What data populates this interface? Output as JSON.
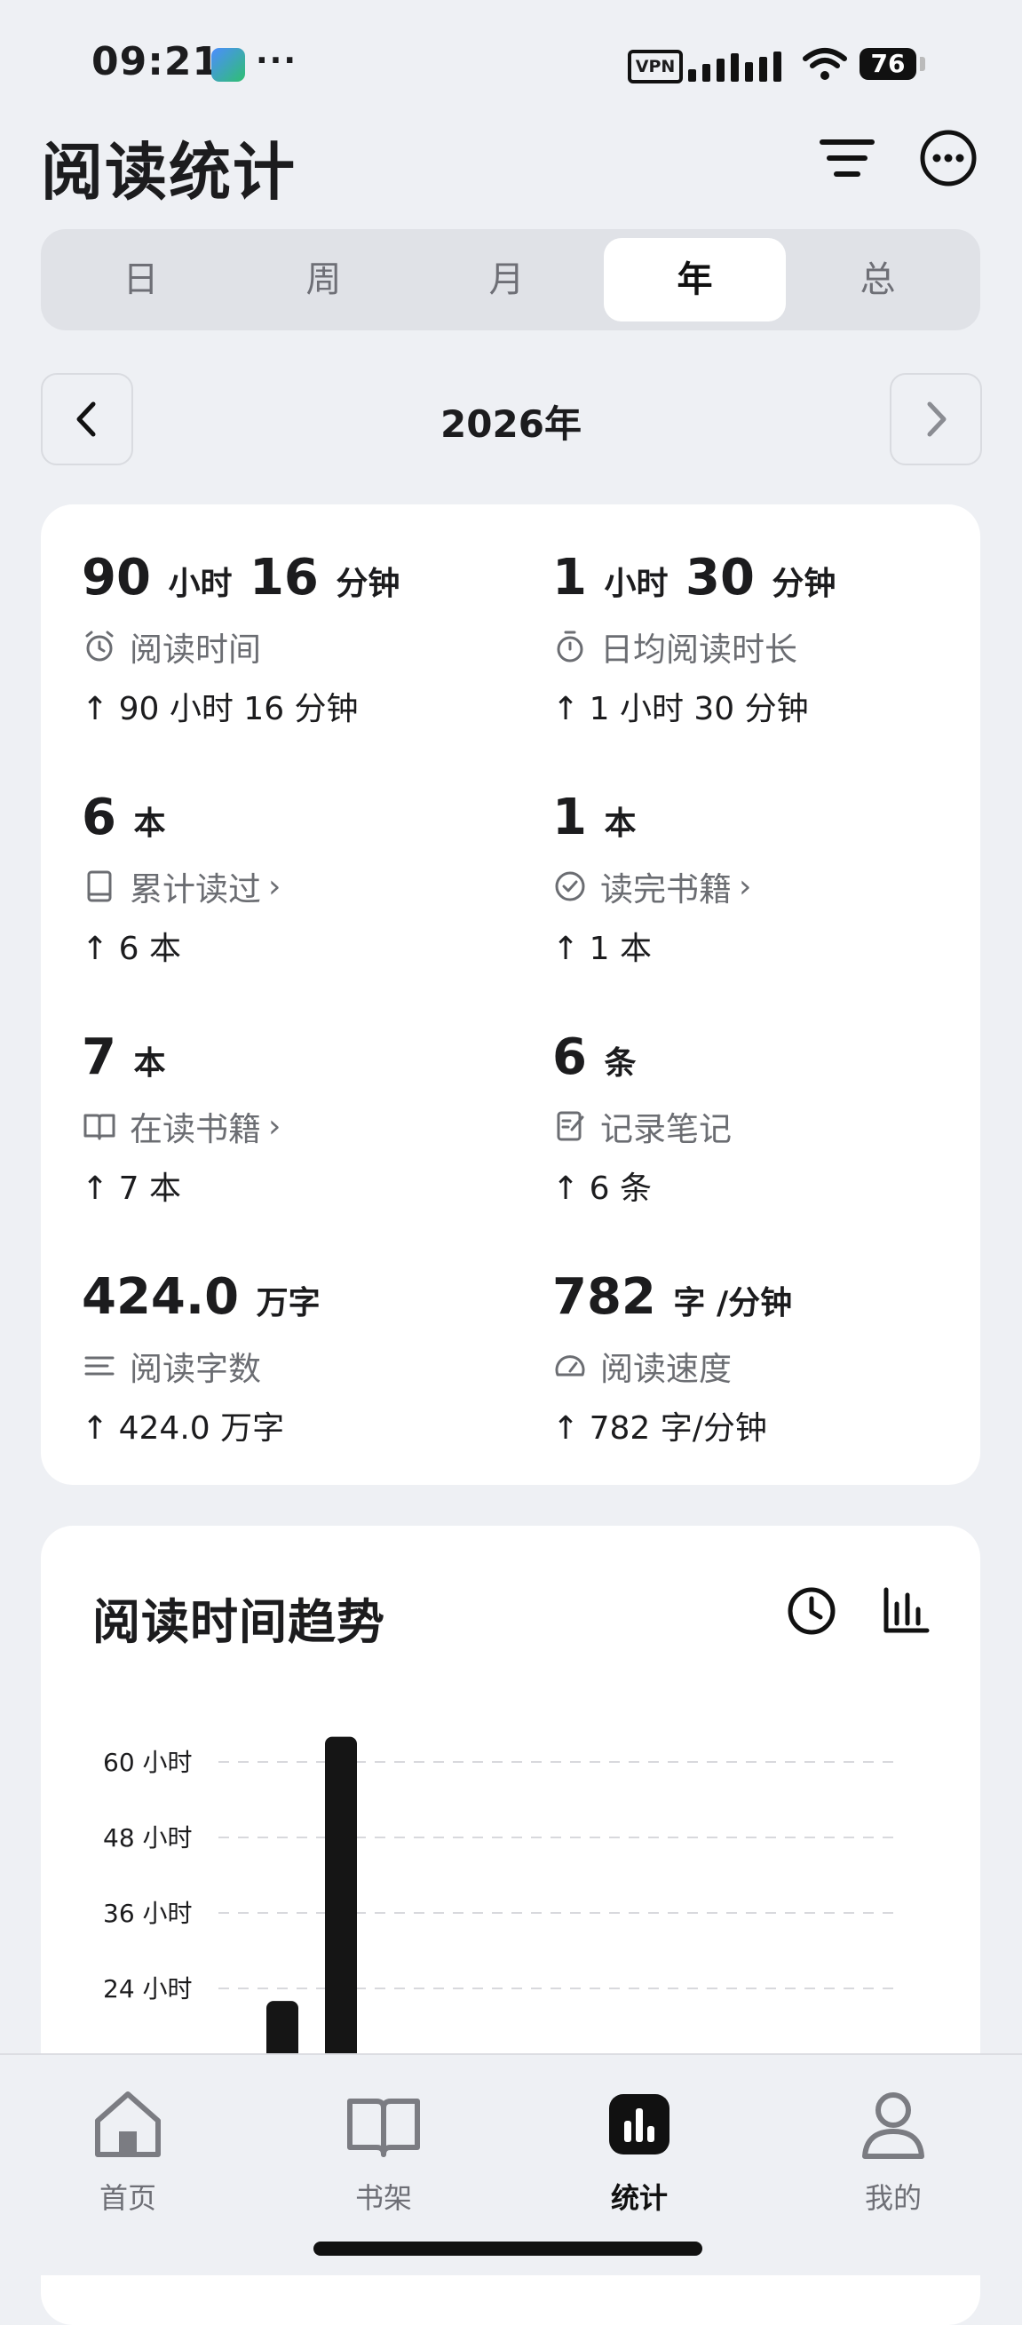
{
  "status_bar": {
    "time": "09:21",
    "dots": "···",
    "vpn": "VPN",
    "battery": "76"
  },
  "header": {
    "title": "阅读统计"
  },
  "segments": [
    {
      "label": "日",
      "active": false
    },
    {
      "label": "周",
      "active": false
    },
    {
      "label": "月",
      "active": false
    },
    {
      "label": "年",
      "active": true
    },
    {
      "label": "总",
      "active": false
    }
  ],
  "period": {
    "label": "2026年"
  },
  "stats": {
    "reading_time": {
      "h": "90",
      "h_unit": "小时",
      "m": "16",
      "m_unit": "分钟",
      "label": "阅读时间",
      "change": "↑ 90 小时 16 分钟"
    },
    "daily_avg": {
      "h": "1",
      "h_unit": "小时",
      "m": "30",
      "m_unit": "分钟",
      "label": "日均阅读时长",
      "change": "↑ 1 小时 30 分钟"
    },
    "books_read": {
      "value": "6",
      "unit": "本",
      "label": "累计读过",
      "change": "↑ 6 本"
    },
    "books_finished": {
      "value": "1",
      "unit": "本",
      "label": "读完书籍",
      "change": "↑ 1 本"
    },
    "books_reading": {
      "value": "7",
      "unit": "本",
      "label": "在读书籍",
      "change": "↑ 7 本"
    },
    "notes": {
      "value": "6",
      "unit": "条",
      "label": "记录笔记",
      "change": "↑ 6 条"
    },
    "words": {
      "value": "424.0",
      "unit": "万字",
      "label": "阅读字数",
      "change": "↑ 424.0 万字"
    },
    "speed": {
      "value": "782",
      "unit": "字 /分钟",
      "label": "阅读速度",
      "change": "↑ 782 字/分钟"
    }
  },
  "chart": {
    "title": "阅读时间趋势",
    "icons": [
      "clock-icon",
      "bar-chart-icon"
    ]
  },
  "chart_data": {
    "type": "bar",
    "title": "阅读时间趋势",
    "ylabel": "",
    "ytick_labels": [
      "60 小时",
      "48 小时",
      "36 小时",
      "24 小时"
    ],
    "ytick_values": [
      60,
      48,
      36,
      24
    ],
    "values": [
      22,
      64
    ],
    "note": ""
  },
  "bottom_nav": [
    {
      "label": "首页",
      "icon": "home-icon",
      "active": false
    },
    {
      "label": "书架",
      "icon": "book-open-icon",
      "active": false
    },
    {
      "label": "统计",
      "icon": "stats-icon",
      "active": true
    },
    {
      "label": "我的",
      "icon": "user-icon",
      "active": false
    }
  ]
}
